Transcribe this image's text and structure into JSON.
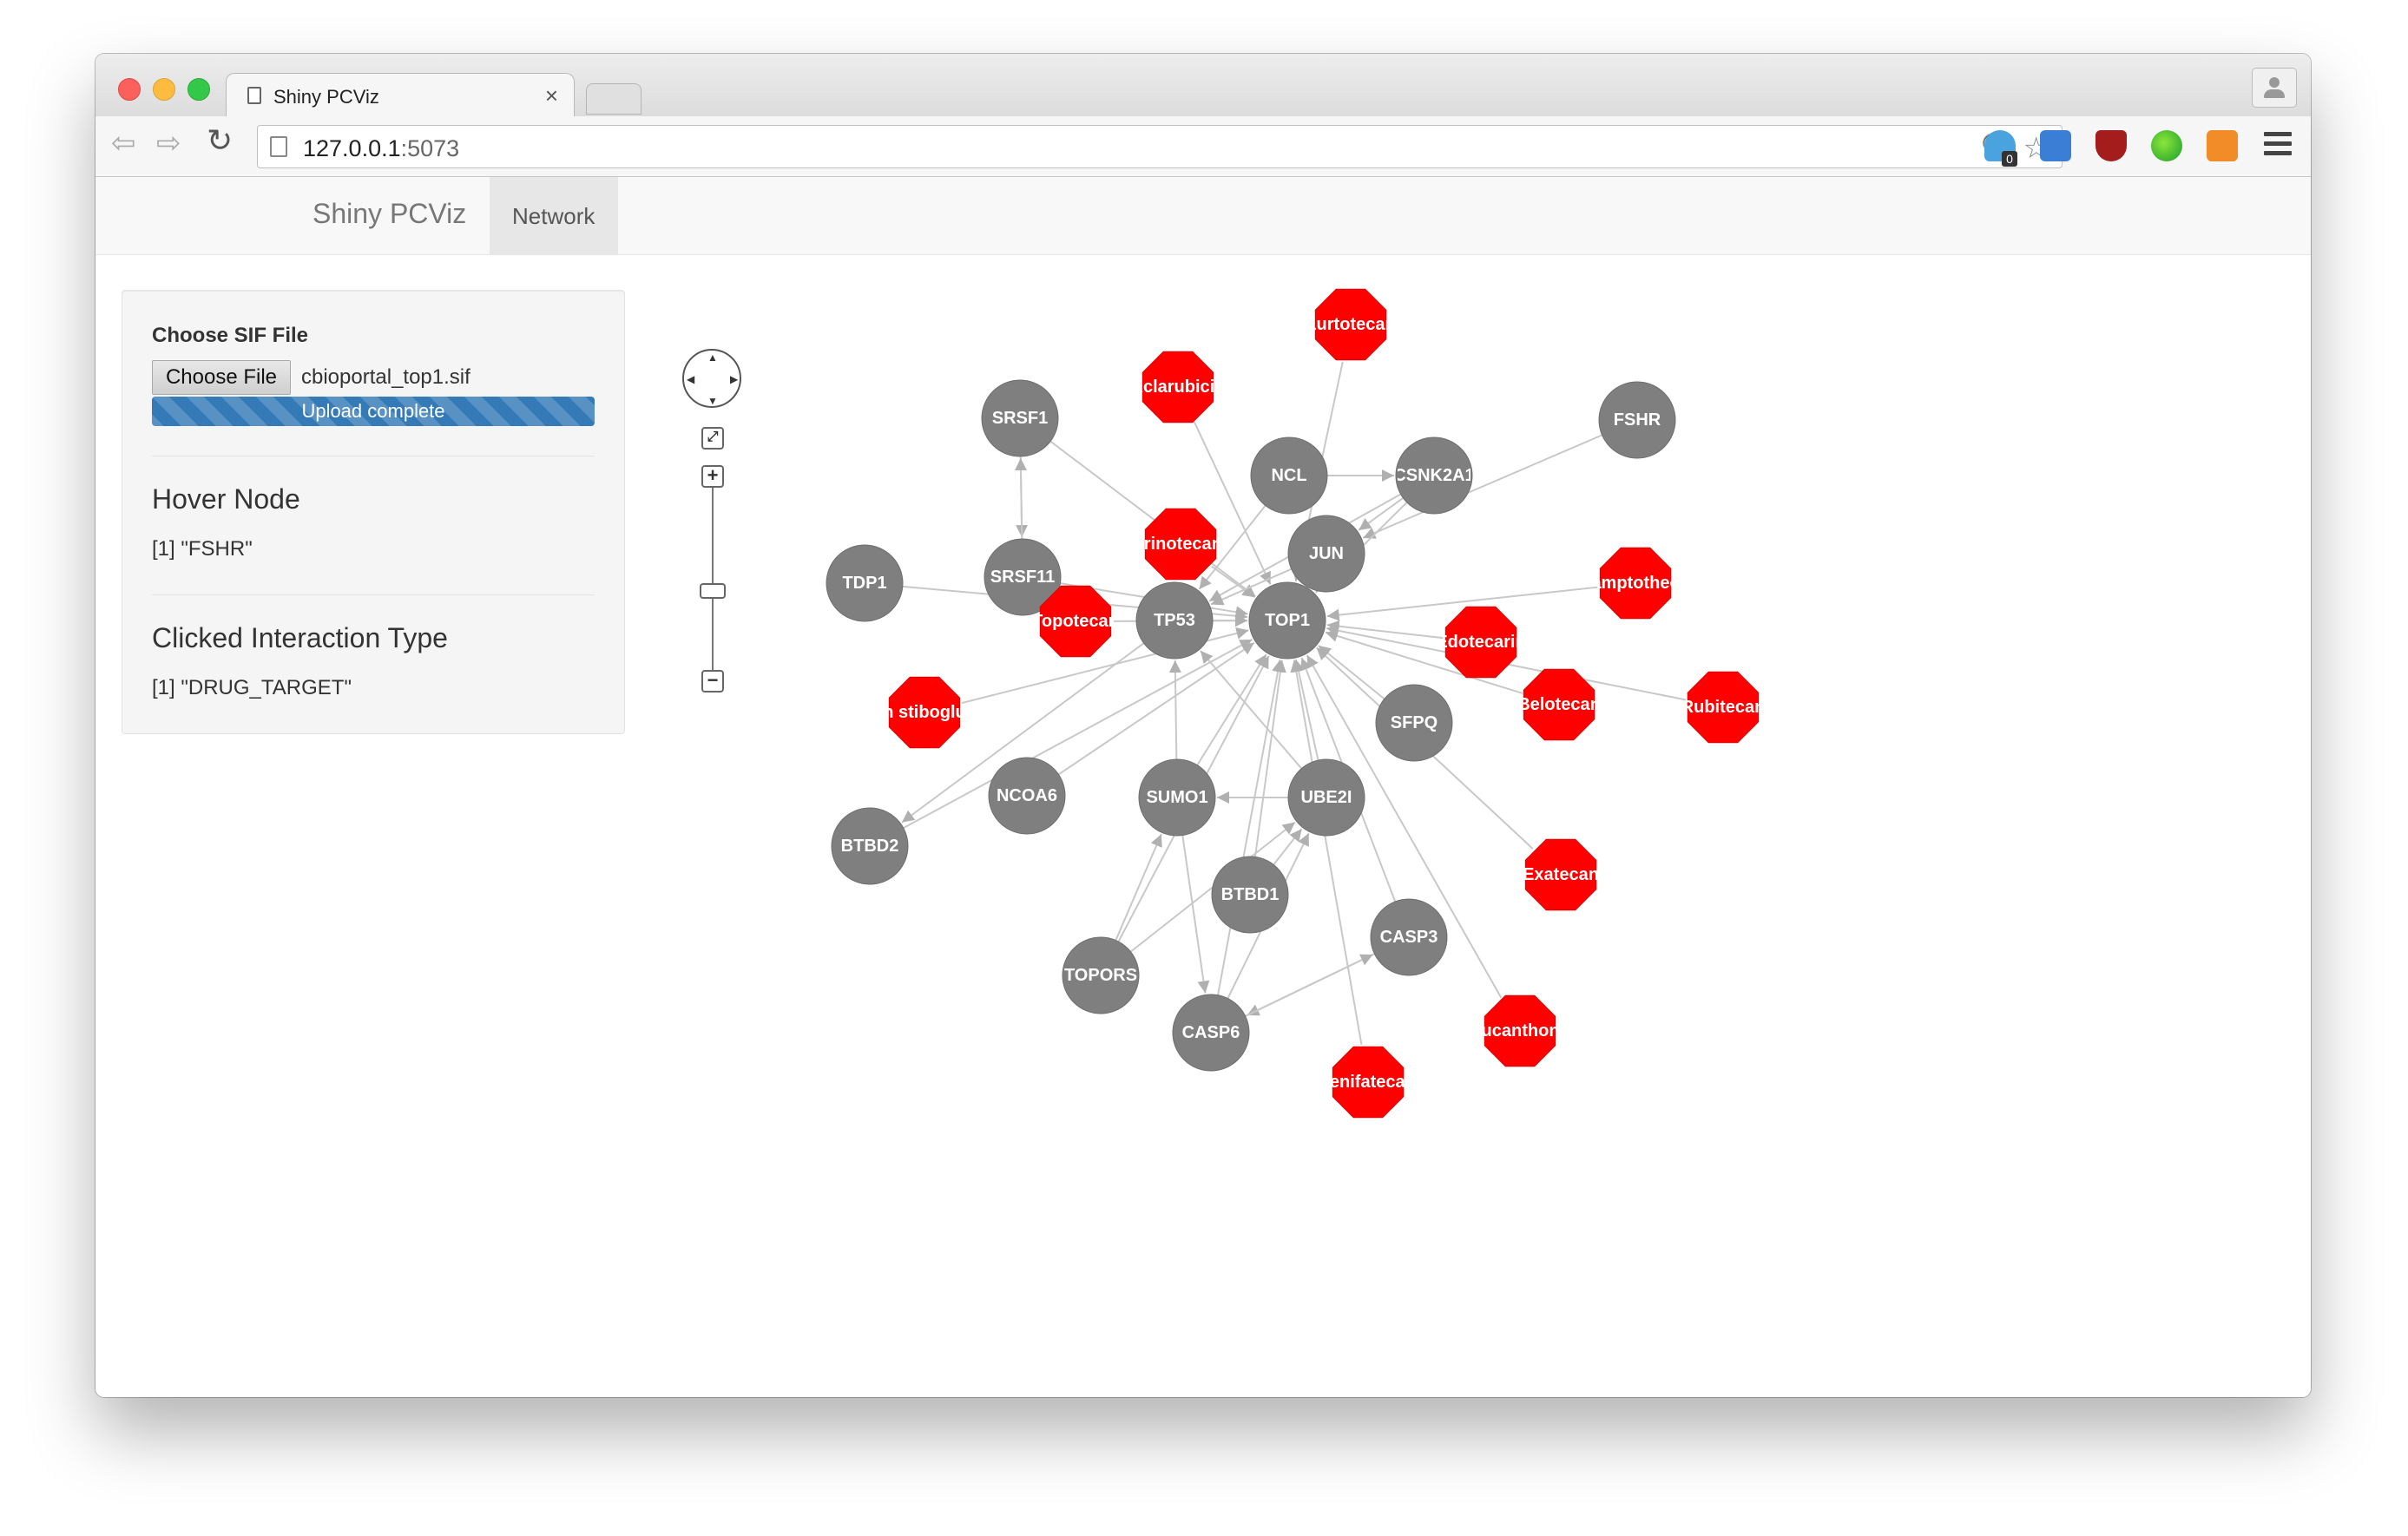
{
  "browser": {
    "tab_title": "Shiny PCViz",
    "tab_close": "×",
    "url_host": "127.0.0.1",
    "url_port": ":5073"
  },
  "app": {
    "brand": "Shiny PCViz",
    "nav_tab": "Network"
  },
  "sidebar": {
    "file_label": "Choose SIF File",
    "file_button": "Choose File",
    "file_name": "cbioportal_top1.sif",
    "upload_status": "Upload complete",
    "upload_progress": 1.0,
    "hover_title": "Hover Node",
    "hover_value": "[1] \"FSHR\"",
    "clicked_title": "Clicked Interaction Type",
    "clicked_value": "[1] \"DRUG_TARGET\""
  },
  "network": {
    "gene_color": "#7f7f7f",
    "drug_color": "#ff0000",
    "nodes": [
      {
        "id": "TOP1",
        "label": "TOP1",
        "type": "gene"
      },
      {
        "id": "TP53",
        "label": "TP53",
        "type": "gene"
      },
      {
        "id": "JUN",
        "label": "JUN",
        "type": "gene"
      },
      {
        "id": "NCL",
        "label": "NCL",
        "type": "gene"
      },
      {
        "id": "CSNK2A1",
        "label": "CSNK2A1",
        "type": "gene"
      },
      {
        "id": "FSHR",
        "label": "FSHR",
        "type": "gene"
      },
      {
        "id": "SRSF1",
        "label": "SRSF1",
        "type": "gene"
      },
      {
        "id": "SRSF11",
        "label": "SRSF11",
        "type": "gene"
      },
      {
        "id": "TDP1",
        "label": "TDP1",
        "type": "gene"
      },
      {
        "id": "SFPQ",
        "label": "SFPQ",
        "type": "gene"
      },
      {
        "id": "UBE2I",
        "label": "UBE2I",
        "type": "gene"
      },
      {
        "id": "SUMO1",
        "label": "SUMO1",
        "type": "gene"
      },
      {
        "id": "NCOA6",
        "label": "NCOA6",
        "type": "gene"
      },
      {
        "id": "BTBD2",
        "label": "BTBD2",
        "type": "gene"
      },
      {
        "id": "BTBD1",
        "label": "BTBD1",
        "type": "gene"
      },
      {
        "id": "CASP3",
        "label": "CASP3",
        "type": "gene"
      },
      {
        "id": "TOPORS",
        "label": "TOPORS",
        "type": "gene"
      },
      {
        "id": "CASP6",
        "label": "CASP6",
        "type": "gene"
      },
      {
        "id": "Lurtotecan",
        "label": "Lurtotecan",
        "type": "drug"
      },
      {
        "id": "Aclarubicin",
        "label": "Aclarubicin",
        "type": "drug"
      },
      {
        "id": "Irinotecan",
        "label": "Irinotecan",
        "type": "drug"
      },
      {
        "id": "Camptothecin",
        "label": "amptothec",
        "type": "drug"
      },
      {
        "id": "Edotecarin",
        "label": "Edotecarin",
        "type": "drug"
      },
      {
        "id": "Topotecan",
        "label": "Topotecan",
        "type": "drug"
      },
      {
        "id": "Stibogluconate",
        "label": "n stiboglu",
        "type": "drug"
      },
      {
        "id": "Belotecan",
        "label": "Belotecan",
        "type": "drug"
      },
      {
        "id": "Rubitecan",
        "label": "Rubitecan",
        "type": "drug"
      },
      {
        "id": "Exatecan",
        "label": "Exatecan",
        "type": "drug"
      },
      {
        "id": "Lucanthone",
        "label": "Lucanthone",
        "type": "drug"
      },
      {
        "id": "Tenifatecan",
        "label": "Tenifatecan",
        "type": "drug"
      }
    ],
    "edges": [
      [
        "Lurtotecan",
        "TOP1"
      ],
      [
        "Aclarubicin",
        "TOP1"
      ],
      [
        "Irinotecan",
        "TOP1"
      ],
      [
        "Camptothecin",
        "TOP1"
      ],
      [
        "Edotecarin",
        "TOP1"
      ],
      [
        "Topotecan",
        "TOP1"
      ],
      [
        "Stibogluconate",
        "TOP1"
      ],
      [
        "Belotecan",
        "TOP1"
      ],
      [
        "Rubitecan",
        "TOP1"
      ],
      [
        "Exatecan",
        "TOP1"
      ],
      [
        "Lucanthone",
        "TOP1"
      ],
      [
        "Tenifatecan",
        "TOP1"
      ],
      [
        "FSHR",
        "JUN"
      ],
      [
        "NCL",
        "CSNK2A1"
      ],
      [
        "CSNK2A1",
        "JUN"
      ],
      [
        "CSNK2A1",
        "TOP1"
      ],
      [
        "CSNK2A1",
        "TP53"
      ],
      [
        "SRSF1",
        "TOP1"
      ],
      [
        "SRSF1",
        "SRSF11"
      ],
      [
        "SRSF11",
        "SRSF1"
      ],
      [
        "SRSF11",
        "TOP1"
      ],
      [
        "TDP1",
        "TOP1"
      ],
      [
        "JUN",
        "TOP1"
      ],
      [
        "JUN",
        "TP53"
      ],
      [
        "TP53",
        "TOP1"
      ],
      [
        "TP53",
        "BTBD2"
      ],
      [
        "NCL",
        "TP53"
      ],
      [
        "SFPQ",
        "TOP1"
      ],
      [
        "UBE2I",
        "TOP1"
      ],
      [
        "UBE2I",
        "SUMO1"
      ],
      [
        "UBE2I",
        "TP53"
      ],
      [
        "SUMO1",
        "TOP1"
      ],
      [
        "SUMO1",
        "TP53"
      ],
      [
        "NCOA6",
        "TOP1"
      ],
      [
        "BTBD2",
        "TOP1"
      ],
      [
        "BTBD1",
        "TOP1"
      ],
      [
        "BTBD1",
        "UBE2I"
      ],
      [
        "CASP3",
        "TOP1"
      ],
      [
        "CASP3",
        "CASP6"
      ],
      [
        "CASP6",
        "CASP3"
      ],
      [
        "TOPORS",
        "TOP1"
      ],
      [
        "TOPORS",
        "SUMO1"
      ],
      [
        "TOPORS",
        "UBE2I"
      ],
      [
        "CASP6",
        "TOP1"
      ],
      [
        "CASP6",
        "UBE2I"
      ],
      [
        "SUMO1",
        "CASP6"
      ]
    ]
  }
}
